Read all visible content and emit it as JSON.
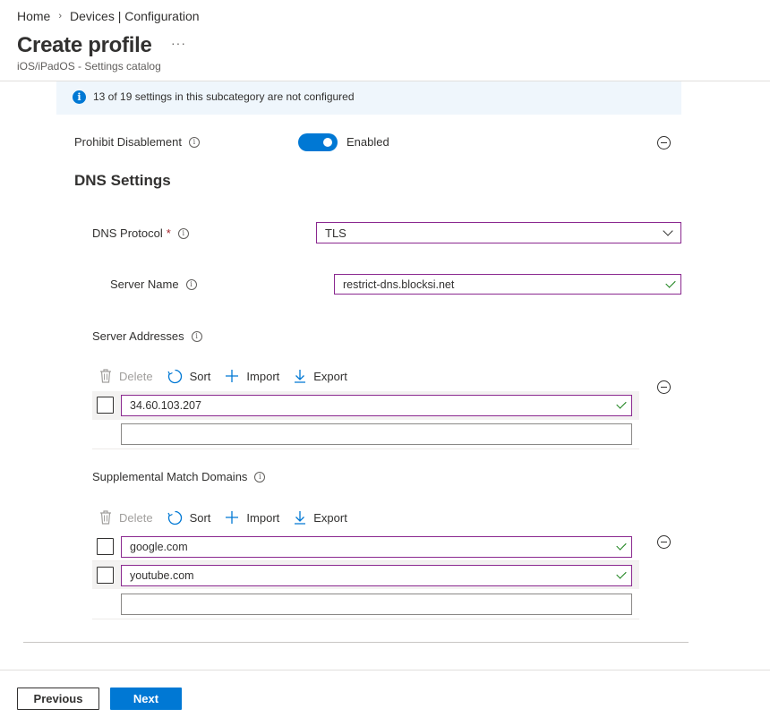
{
  "breadcrumb": {
    "home": "Home",
    "separator": "›",
    "current": "Devices | Configuration"
  },
  "header": {
    "title": "Create profile",
    "more": "···",
    "subtitle": "iOS/iPadOS - Settings catalog"
  },
  "info_bar": {
    "icon": "info-icon",
    "text": "13 of 19 settings in this subcategory are not configured"
  },
  "prohibit_disablement": {
    "label": "Prohibit Disablement",
    "toggle_state": "Enabled",
    "enabled": true
  },
  "dns_settings": {
    "title": "DNS Settings",
    "dns_protocol": {
      "label": "DNS Protocol",
      "required_marker": "*",
      "value": "TLS"
    },
    "server_name": {
      "label": "Server Name",
      "value": "restrict-dns.blocksi.net"
    },
    "server_addresses": {
      "label": "Server Addresses",
      "toolbar": {
        "delete": "Delete",
        "sort": "Sort",
        "import": "Import",
        "export": "Export"
      },
      "rows": [
        "34.60.103.207"
      ],
      "new_row_value": ""
    },
    "supplemental_match_domains": {
      "label": "Supplemental Match Domains",
      "toolbar": {
        "delete": "Delete",
        "sort": "Sort",
        "import": "Import",
        "export": "Export"
      },
      "rows": [
        "google.com",
        "youtube.com"
      ],
      "new_row_value": ""
    }
  },
  "footer": {
    "previous": "Previous",
    "next": "Next"
  },
  "colors": {
    "accent": "#0078d4",
    "field_border": "#8a288f",
    "valid_check": "#107c10",
    "required": "#a4262c"
  }
}
